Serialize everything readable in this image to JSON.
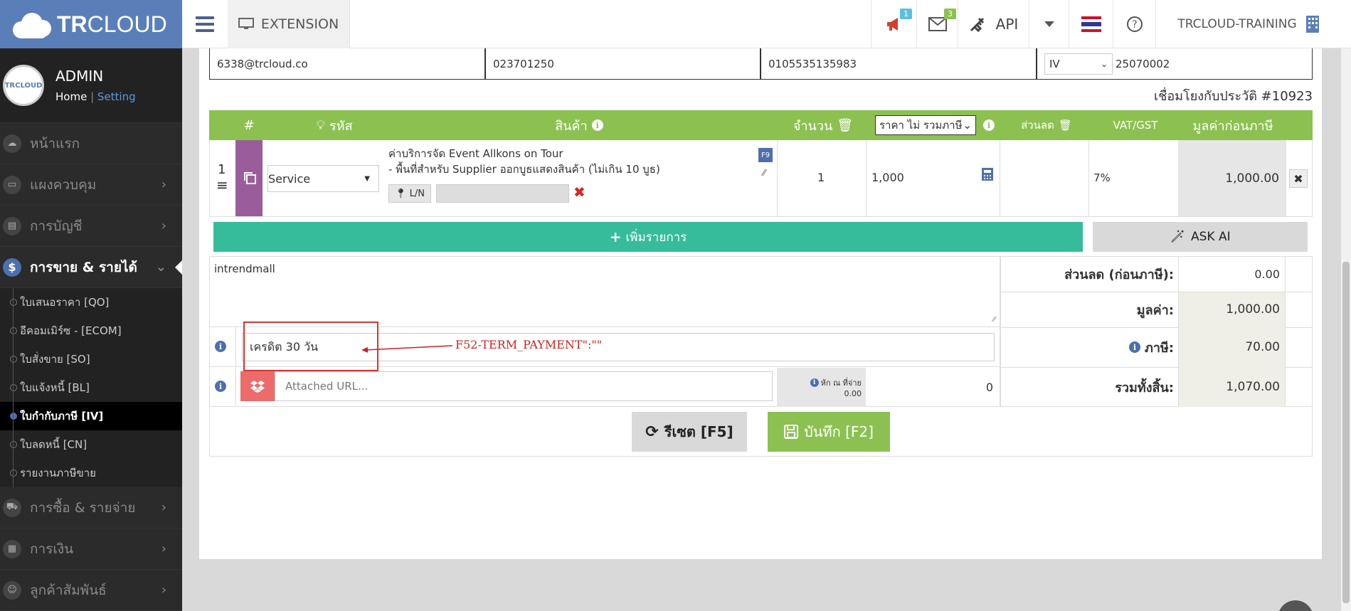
{
  "header": {
    "brand_tr": "TR",
    "brand_cloud": "CLOUD",
    "extension_label": "EXTENSION",
    "announce_badge": "1",
    "mail_badge": "3",
    "api_label": "API",
    "company_name": "TRCLOUD-TRAINING",
    "colors": {
      "brand": "#5a7fb8",
      "accent_green": "#8cc152",
      "teal": "#37bc9b"
    }
  },
  "sidebar": {
    "user_name": "ADMIN",
    "home_link": "Home",
    "separator": "|",
    "setting_link": "Setting",
    "avatar_text": "TRCLOUD",
    "menu": [
      {
        "label": "หน้าแรก",
        "icon": "cloud-icon"
      },
      {
        "label": "แผงควบคุม",
        "icon": "monitor-icon"
      },
      {
        "label": "การบัญชี",
        "icon": "book-icon"
      },
      {
        "label": "การขาย & รายได้",
        "icon": "dollar-icon"
      },
      {
        "label": "การซื้อ & รายจ่าย",
        "icon": "cart-icon"
      },
      {
        "label": "การเงิน",
        "icon": "calendar-icon"
      },
      {
        "label": "ลูกค้าสัมพันธ์",
        "icon": "users-icon"
      }
    ],
    "submenu": [
      {
        "label": "ใบเสนอราคา [QO]"
      },
      {
        "label": "อีคอมเมิร์ซ - [ECOM]"
      },
      {
        "label": "ใบสั่งขาย [SO]"
      },
      {
        "label": "ใบแจ้งหนี้ [BL]"
      },
      {
        "label": "ใบกำกับภาษี [IV]"
      },
      {
        "label": "ใบลดหนี้ [CN]"
      },
      {
        "label": "รายงานภาษีขาย"
      }
    ]
  },
  "customer_row": {
    "email": "6338@trcloud.co",
    "phone": "023701250",
    "tax_id": "0105535135983",
    "doc_type": "IV",
    "doc_number": "25070002"
  },
  "history_link": "เชื่อมโยงกับประวัติ #10923",
  "table": {
    "headers": {
      "index": "#",
      "code": "รหัส",
      "product": "สินค้า",
      "qty": "จำนวน",
      "price_select": "ราคา ไม่ รวมภาษี",
      "discount": "ส่วนลด",
      "vat": "VAT/GST",
      "amount": "มูลค่าก่อนภาษี"
    },
    "row": {
      "num": "1",
      "item_type": "Service",
      "desc_line1": "ค่าบริการจัด Event Allkons on Tour",
      "desc_line2": "- พื้นที่สำหรับ Supplier ออกบูธแสดงสินค้า (ไม่เกิน 10 บูธ)",
      "f9": "F9",
      "ln_label": "L/N",
      "qty": "1",
      "price": "1,000",
      "vat": "7%",
      "amount": "1,000.00"
    },
    "add_button": "เพิ่มรายการ",
    "ask_ai": "ASK AI"
  },
  "notes": {
    "text": "intrendmall",
    "payment_term": "เครดิต 30 วัน",
    "annotation": "F52-TERM_PAYMENT\":\"\"",
    "attached_placeholder": "Attached URL...",
    "withholding_label": "หัก ณ ที่จ่าย",
    "withholding_value": "0.00",
    "withholding_total": "0"
  },
  "summary": {
    "discount_label": "ส่วนลด (ก่อนภาษี):",
    "discount_value": "0.00",
    "value_label": "มูลค่า:",
    "value_value": "1,000.00",
    "tax_label": "ภาษี:",
    "tax_value": "70.00",
    "total_label": "รวมทั้งสิ้น:",
    "total_value": "1,070.00"
  },
  "actions": {
    "reset": "รีเซต [F5]",
    "save": "บันทึก [F2]"
  }
}
